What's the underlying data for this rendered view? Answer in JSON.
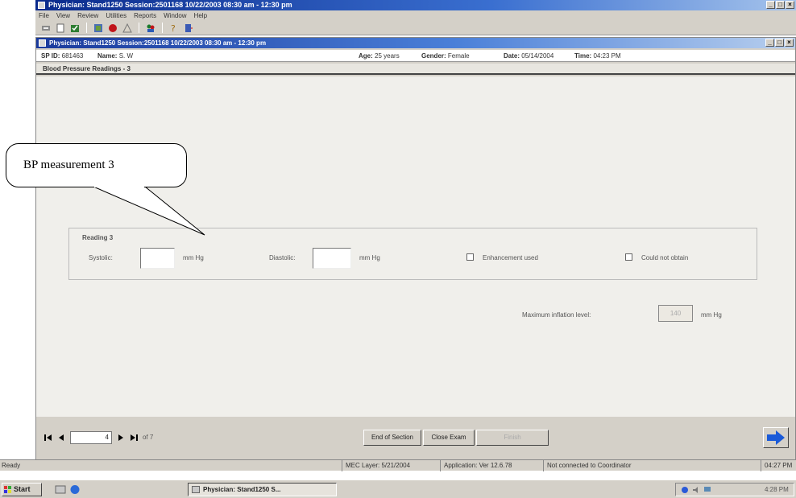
{
  "app": {
    "title": "Physician: Stand1250 Session:2501168 10/22/2003 08:30 am - 12:30 pm",
    "menu": [
      "File",
      "View",
      "Review",
      "Utilities",
      "Reports",
      "Window",
      "Help"
    ],
    "toolbar_icons": [
      "exit-icon",
      "new-icon",
      "checklist-icon",
      "grid-icon",
      "record-icon",
      "warning-icon",
      "people-icon",
      "help-icon",
      "door-icon"
    ]
  },
  "window": {
    "title": "Physician: Stand1250 Session:2501168 10/22/2003 08:30 am - 12:30 pm",
    "sp_id_label": "SP ID:",
    "sp_id": "681463",
    "name_label": "Name:",
    "name": "S. W",
    "age_label": "Age:",
    "age": "25 years",
    "gender_label": "Gender:",
    "gender": "Female",
    "date_label": "Date:",
    "date": "05/14/2004",
    "time_label": "Time:",
    "time": "04:23 PM",
    "section_title": "Blood Pressure Readings - 3"
  },
  "reading": {
    "group_label": "Reading 3",
    "systolic_label": "Systolic:",
    "systolic_value": "",
    "systolic_unit": "mm Hg",
    "diastolic_label": "Diastolic:",
    "diastolic_value": "",
    "diastolic_unit": "mm Hg",
    "enhancement_label": "Enhancement used",
    "could_not_obtain_label": "Could not obtain",
    "max_inflation_label": "Maximum inflation level:",
    "max_inflation_value": "140",
    "max_inflation_unit": "mm Hg"
  },
  "nav": {
    "record_number": "4",
    "record_total": "of 7",
    "end_of_section": "End of Section",
    "close_exam": "Close Exam",
    "finish": "Finish"
  },
  "status": {
    "ready": "Ready",
    "mec_layer": "MEC Layer: 5/21/2004",
    "app_version": "Application: Ver 12.6.78",
    "coordinator": "Not connected to Coordinator",
    "time": "04:27 PM"
  },
  "taskbar": {
    "start": "Start",
    "task": "Physician: Stand1250 S...",
    "clock": "4:28 PM"
  },
  "callout": {
    "text": "BP measurement 3"
  }
}
